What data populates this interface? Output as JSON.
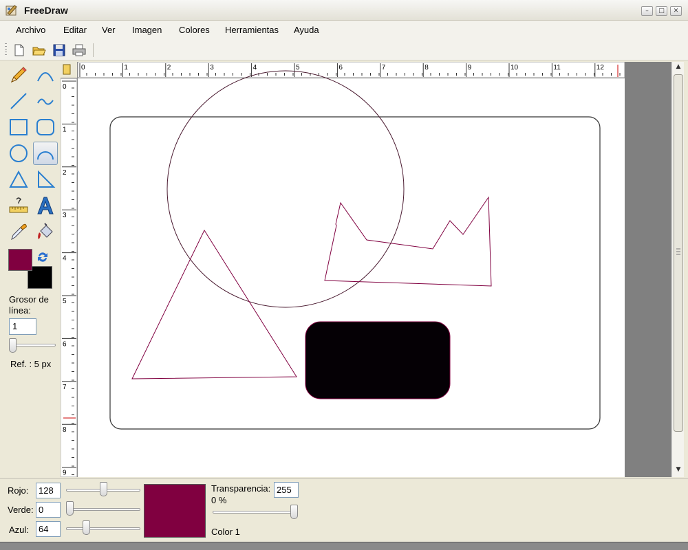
{
  "window": {
    "title": "FreeDraw",
    "minimize_glyph": "–",
    "maximize_glyph": "□",
    "close_glyph": "✕"
  },
  "menu": {
    "items": [
      "Archivo",
      "Editar",
      "Ver",
      "Imagen",
      "Colores",
      "Herramientas",
      "Ayuda"
    ]
  },
  "toolbar": {
    "buttons": [
      "new-file-icon",
      "open-folder-icon",
      "save-disk-icon",
      "print-icon"
    ]
  },
  "tools": {
    "items": [
      "pencil",
      "curve",
      "line",
      "freehand",
      "rectangle",
      "rounded-rectangle",
      "ellipse",
      "arc",
      "triangle",
      "right-triangle",
      "ruler-measure",
      "text",
      "eyedropper",
      "paint-bucket"
    ],
    "active": "arc"
  },
  "colors": {
    "primary": "#800040",
    "secondary": "#000000",
    "accent_text": "Grosor de línea:",
    "line_width_value": "1",
    "line_width_slider_fraction": 0.0,
    "ref_text": "Ref. : 5 px"
  },
  "rulers": {
    "horizontal_labels": [
      "0",
      "1",
      "2",
      "3",
      "4",
      "5",
      "6",
      "7",
      "8",
      "9",
      "10",
      "11",
      "12"
    ],
    "vertical_labels": [
      "0",
      "1",
      "2",
      "3",
      "4",
      "5",
      "6",
      "7",
      "8",
      "9"
    ]
  },
  "color_panel": {
    "red_label": "Rojo:",
    "red_value": "128",
    "red_fraction": 0.502,
    "green_label": "Verde:",
    "green_value": "0",
    "green_fraction": 0.0,
    "blue_label": "Azul:",
    "blue_value": "64",
    "blue_fraction": 0.251,
    "preview_color": "#800040",
    "transparency_label": "Transparencia:",
    "transparency_value": "255",
    "transparency_percent": "0 %",
    "transparency_fraction": 1.0,
    "color_slot_label": "Color 1"
  }
}
